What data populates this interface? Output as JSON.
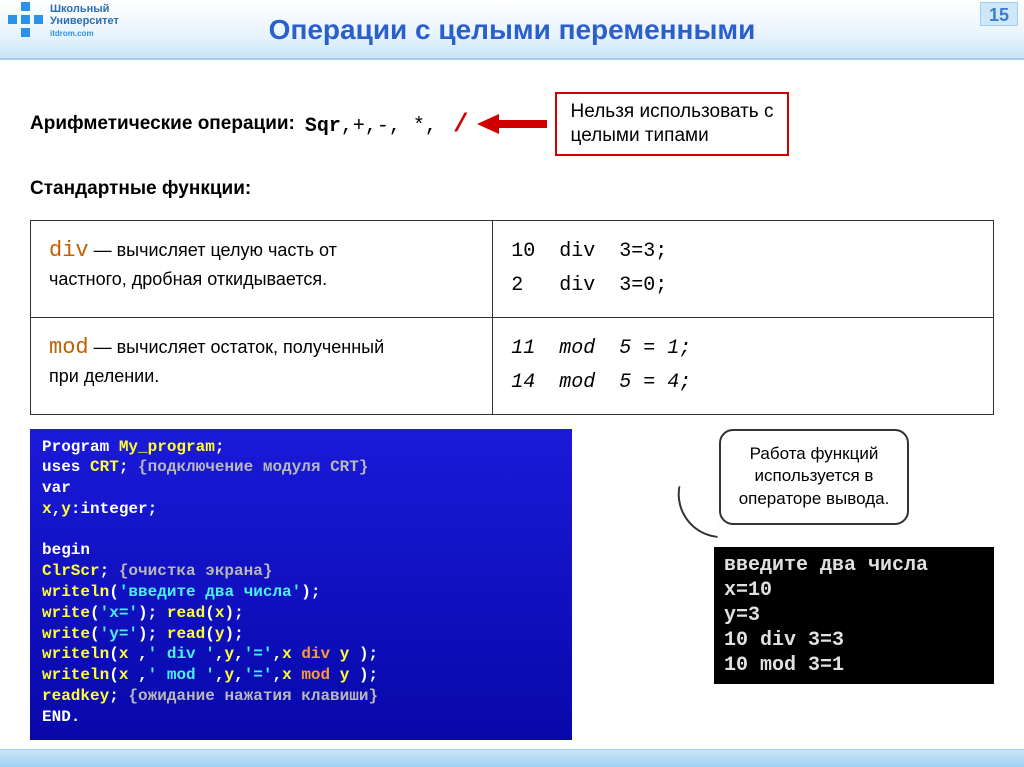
{
  "header": {
    "logo_line1": "Школьный",
    "logo_line2": "Университет",
    "logo_sub": "itdrom.com",
    "title": "Операции с целыми переменными",
    "page_number": "15"
  },
  "arith": {
    "label": "Арифметические операции:",
    "ops_prefix": "Sqr",
    "ops_rest": ",+,-,  *,",
    "slash": "/"
  },
  "warn": {
    "line1": "Нельзя использовать с",
    "line2": "целыми типами"
  },
  "std_label": "Стандартные функции:",
  "funcs": {
    "div": {
      "kw": "div",
      "desc1": " — вычисляет целую часть от",
      "desc2": "частного, дробная откидывается.",
      "ex": "10  div  3=3;\n2   div  3=0;"
    },
    "mod": {
      "kw": "mod",
      "desc1": " — вычисляет остаток, полученный",
      "desc2": "при делении.",
      "ex": "11  mod  5 = 1;\n14  mod  5 = 4;"
    }
  },
  "code": {
    "l1a": "Program ",
    "l1b": "My_program",
    "l1c": ";",
    "l2a": "uses ",
    "l2b": "CRT",
    "l2c": ";  ",
    "l2d": "{подключение модуля CRT}",
    "l3": "var",
    "l4a": "    x",
    "l4b": ",",
    "l4c": "y",
    "l4d": ":",
    "l4e": "integer",
    "l4f": ";",
    "l5": "begin",
    "l6a": "ClrScr",
    "l6b": ";  ",
    "l6c": "{очистка экрана}",
    "l7a": "writeln",
    "l7b": "(",
    "l7c": "'введите два числа'",
    "l7d": ")",
    "l7e": ";",
    "l8a": "write",
    "l8b": "(",
    "l8c": "'x='",
    "l8d": ")",
    "l8e": ";  ",
    "l8f": "read",
    "l8g": "(",
    "l8h": "x",
    "l8i": ")",
    "l8j": ";",
    "l9a": "write",
    "l9b": "(",
    "l9c": "'y='",
    "l9d": ")",
    "l9e": ";  ",
    "l9f": "read",
    "l9g": "(",
    "l9h": "y",
    "l9i": ")",
    "l9j": ";",
    "l10a": "writeln",
    "l10b": "(",
    "l10c": "x",
    "l10d": " ,",
    "l10e": "' div '",
    "l10f": ",",
    "l10g": "y",
    "l10h": ",",
    "l10i": "'='",
    "l10j": ",",
    "l10k": "x ",
    "l10l": "div",
    "l10m": " y ",
    "l10n": ")",
    "l10o": ";",
    "l11a": "writeln",
    "l11b": "(",
    "l11c": "x",
    "l11d": " ,",
    "l11e": "' mod '",
    "l11f": ",",
    "l11g": "y",
    "l11h": ",",
    "l11i": "'='",
    "l11j": ",",
    "l11k": "x ",
    "l11l": "mod",
    "l11m": " y ",
    "l11n": ")",
    "l11o": ";",
    "l12a": "readkey",
    "l12b": ";  ",
    "l12c": "{ожидание нажатия клавиши}",
    "l13": "END."
  },
  "bubble": {
    "l1": "Работа функций",
    "l2": "используется в",
    "l3": "операторе вывода."
  },
  "console": "введите два числа\nx=10\ny=3\n10 div 3=3\n10 mod 3=1"
}
